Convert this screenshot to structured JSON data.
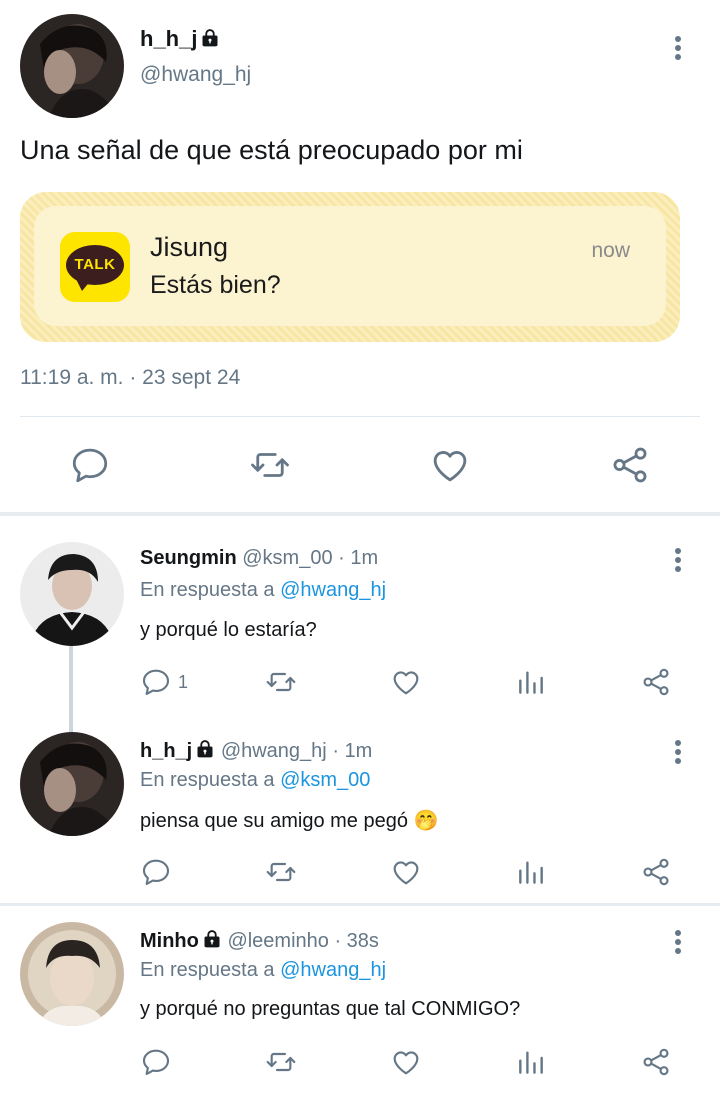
{
  "main_tweet": {
    "name": "h_h_j",
    "handle": "@hwang_hj",
    "text": "Una señal de que está preocupado por mi",
    "notification": {
      "app_icon_text": "TALK",
      "sender": "Jisung",
      "message": "Estás bien?",
      "time": "now"
    },
    "timestamp": "11:19 a. m. · 23 sept 24"
  },
  "replies": [
    {
      "name": "Seungmin",
      "handle": "@ksm_00",
      "time": "· 1m",
      "reply_prefix": "En respuesta a ",
      "reply_to": "@hwang_hj",
      "text": "y porqué lo estaría?",
      "reply_count": "1",
      "locked": false
    },
    {
      "name": "h_h_j",
      "handle": "@hwang_hj",
      "time": "· 1m",
      "reply_prefix": "En respuesta a ",
      "reply_to": "@ksm_00",
      "text": "piensa que su amigo me pegó 🤭",
      "reply_count": "",
      "locked": true
    },
    {
      "name": "Minho",
      "handle": "@leeminho",
      "time": "· 38s",
      "reply_prefix": "En respuesta a ",
      "reply_to": "@hwang_hj",
      "text": "y porqué no preguntas que tal CONMIGO?",
      "reply_count": "",
      "locked": true
    }
  ],
  "colors": {
    "text": "#14171a",
    "secondary": "#657786",
    "link": "#1b95e0",
    "kakao_yellow": "#fee500",
    "notification_bg": "#fcf3d1"
  }
}
